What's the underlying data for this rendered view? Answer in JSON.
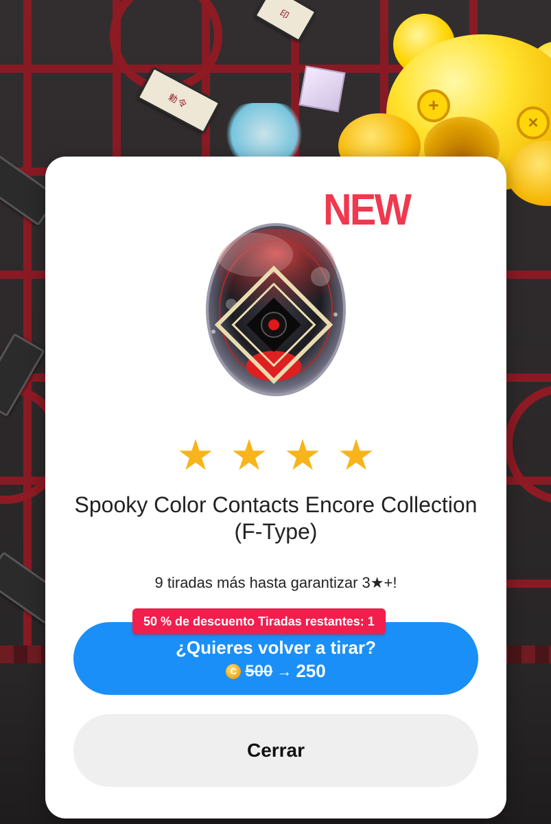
{
  "background": {
    "talismans": [
      "勅令",
      "印"
    ]
  },
  "card": {
    "badge": "NEW",
    "item_image_icon": "color-contact-lens-icon",
    "star_count": 4,
    "star_glyph": "★",
    "item_name": "Spooky Color Contacts Encore Collection (F-Type)",
    "pity_text": "9 tiradas más hasta garantizar 3★+!",
    "discount_tag": "50 % de descuento Tiradas restantes: 1",
    "reroll": {
      "title": "¿Quieres volver a tirar?",
      "coin_icon": "coin-icon",
      "coin_symbol": "C",
      "old_price": "500",
      "arrow": "→",
      "new_price": "250"
    },
    "close_label": "Cerrar"
  },
  "colors": {
    "new_badge": "#f0384e",
    "star": "#f8b41b",
    "reroll_button": "#1a8ff7",
    "discount_tag": "#f01f4d",
    "close_button": "#efefef"
  }
}
